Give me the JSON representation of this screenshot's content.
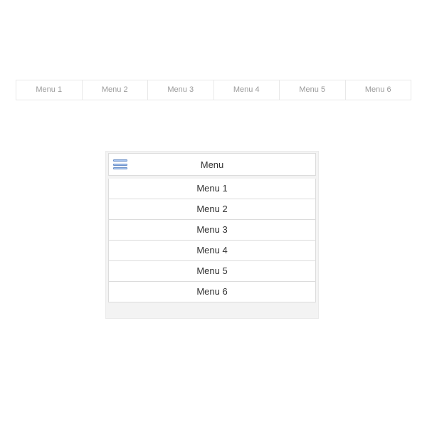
{
  "top_menu": {
    "items": [
      {
        "label": "Menu 1"
      },
      {
        "label": "Menu 2"
      },
      {
        "label": "Menu 3"
      },
      {
        "label": "Menu 4"
      },
      {
        "label": "Menu 5"
      },
      {
        "label": "Menu 6"
      }
    ]
  },
  "mobile_menu": {
    "title": "Menu",
    "hamburger_icon": "hamburger-icon",
    "items": [
      {
        "label": "Menu 1"
      },
      {
        "label": "Menu 2"
      },
      {
        "label": "Menu 3"
      },
      {
        "label": "Menu 4"
      },
      {
        "label": "Menu 5"
      },
      {
        "label": "Menu 6"
      }
    ]
  }
}
